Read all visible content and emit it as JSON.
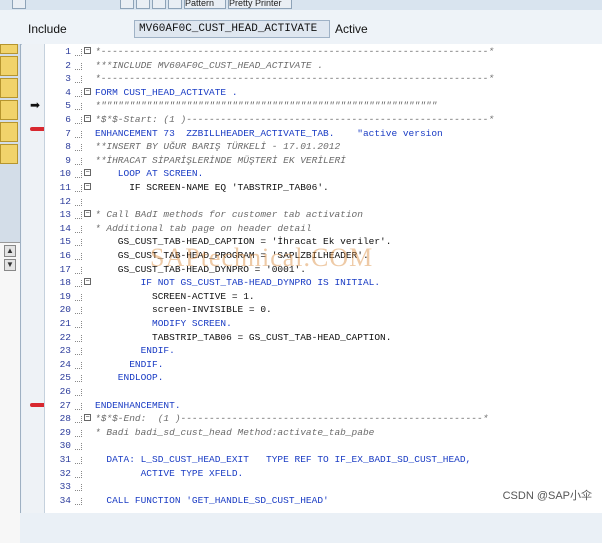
{
  "toolbar": {
    "button1_label": "Pattern",
    "button2_label": "Pretty Printer"
  },
  "header": {
    "include_label": "Include",
    "include_value": "MV60AF0C_CUST_HEAD_ACTIVATE",
    "status": "Active"
  },
  "editor": {
    "lines": [
      {
        "num": "1",
        "text": "*--------------------------------------------------------------------*",
        "style": "c-gray",
        "fold": true
      },
      {
        "num": "2",
        "text": "***INCLUDE MV60AF0C_CUST_HEAD_ACTIVATE .",
        "style": "c-gray",
        "fold": false
      },
      {
        "num": "3",
        "text": "*--------------------------------------------------------------------*",
        "style": "c-gray",
        "fold": false
      },
      {
        "num": "4",
        "text": "FORM CUST_HEAD_ACTIVATE .",
        "style": "c-blue",
        "fold": true
      },
      {
        "num": "5",
        "text": "*\"\"\"\"\"\"\"\"\"\"\"\"\"\"\"\"\"\"\"\"\"\"\"\"\"\"\"\"\"\"\"\"\"\"\"\"\"\"\"\"\"\"\"\"\"\"\"\"\"\"\"\"\"\"\"\"\"\"\"",
        "style": "c-gray",
        "fold": false
      },
      {
        "num": "6",
        "text": "*$*$-Start: (1 )-----------------------------------------------------*",
        "style": "c-gray",
        "fold": true
      },
      {
        "num": "7",
        "text": "ENHANCEMENT 73  ZZBILLHEADER_ACTIVATE_TAB.    \"active version",
        "style": "c-blue",
        "fold": false
      },
      {
        "num": "8",
        "text": "**INSERT BY UĞUR BARIŞ TÜRKELİ - 17.01.2012",
        "style": "c-gray",
        "fold": false
      },
      {
        "num": "9",
        "text": "**İHRACAT SİPARİŞLERİNDE MÜŞTERİ EK VERİLERİ",
        "style": "c-gray",
        "fold": false
      },
      {
        "num": "10",
        "text": "    LOOP AT SCREEN.",
        "style": "c-blue",
        "fold": true
      },
      {
        "num": "11",
        "text": "      IF SCREEN-NAME EQ 'TABSTRIP_TAB06'.",
        "style": "",
        "fold": true
      },
      {
        "num": "12",
        "text": "",
        "style": "",
        "fold": false
      },
      {
        "num": "13",
        "text": "* Call BAdI methods for customer tab activation",
        "style": "c-gray",
        "fold": true
      },
      {
        "num": "14",
        "text": "* Additional tab page on header detail",
        "style": "c-gray",
        "fold": false
      },
      {
        "num": "15",
        "text": "    GS_CUST_TAB-HEAD_CAPTION = 'İhracat Ek veriler'.",
        "style": "",
        "fold": false
      },
      {
        "num": "16",
        "text": "    GS_CUST_TAB-HEAD_PROGRAM = 'SAPLZBILHEADER'.",
        "style": "",
        "fold": false
      },
      {
        "num": "17",
        "text": "    GS_CUST_TAB-HEAD_DYNPRO = '0001'.",
        "style": "",
        "fold": false
      },
      {
        "num": "18",
        "text": "        IF NOT GS_CUST_TAB-HEAD_DYNPRO IS INITIAL.",
        "style": "c-blue",
        "fold": true
      },
      {
        "num": "19",
        "text": "          SCREEN-ACTIVE = 1.",
        "style": "",
        "fold": false
      },
      {
        "num": "20",
        "text": "          screen-INVISIBLE = 0.",
        "style": "",
        "fold": false
      },
      {
        "num": "21",
        "text": "          MODIFY SCREEN.",
        "style": "c-blue",
        "fold": false
      },
      {
        "num": "22",
        "text": "          TABSTRIP_TAB06 = GS_CUST_TAB-HEAD_CAPTION.",
        "style": "",
        "fold": false
      },
      {
        "num": "23",
        "text": "        ENDIF.",
        "style": "c-blue",
        "fold": false
      },
      {
        "num": "24",
        "text": "      ENDIF.",
        "style": "c-blue",
        "fold": false
      },
      {
        "num": "25",
        "text": "    ENDLOOP.",
        "style": "c-blue",
        "fold": false
      },
      {
        "num": "26",
        "text": "",
        "style": "",
        "fold": false
      },
      {
        "num": "27",
        "text": "ENDENHANCEMENT.",
        "style": "c-blue",
        "fold": false
      },
      {
        "num": "28",
        "text": "*$*$-End:  (1 )-----------------------------------------------------*",
        "style": "c-gray",
        "fold": true
      },
      {
        "num": "29",
        "text": "* Badi badi_sd_cust_head Method:activate_tab_pabe",
        "style": "c-gray",
        "fold": false
      },
      {
        "num": "30",
        "text": "",
        "style": "",
        "fold": false
      },
      {
        "num": "31",
        "text": "  DATA: L_SD_CUST_HEAD_EXIT   TYPE REF TO IF_EX_BADI_SD_CUST_HEAD,",
        "style": "c-blue",
        "fold": false
      },
      {
        "num": "32",
        "text": "        ACTIVE TYPE XFELD.",
        "style": "c-blue",
        "fold": false
      },
      {
        "num": "33",
        "text": "",
        "style": "",
        "fold": false
      },
      {
        "num": "34",
        "text": "  CALL FUNCTION 'GET_HANDLE_SD_CUST_HEAD'",
        "style": "c-blue",
        "fold": false
      }
    ]
  },
  "watermark": "SAPtechnical.COM",
  "footer": {
    "credit": "CSDN @SAP小伞"
  }
}
